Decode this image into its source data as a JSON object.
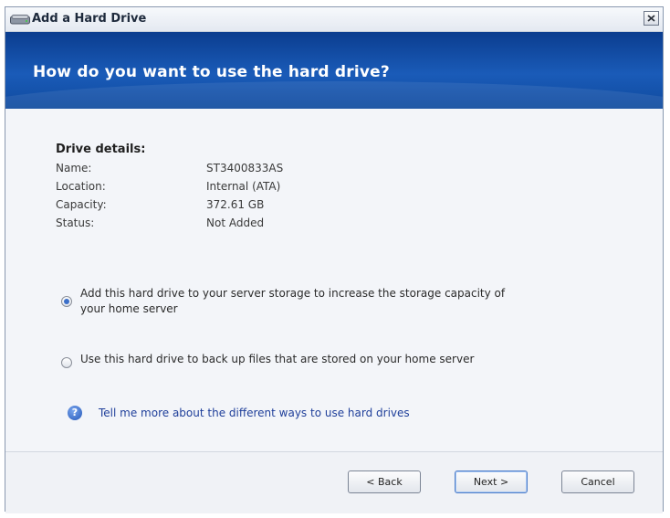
{
  "window": {
    "title": "Add a Hard Drive",
    "close_label": "×"
  },
  "header": {
    "title": "How do you want to use the hard drive?"
  },
  "details": {
    "title": "Drive details:",
    "rows": [
      {
        "label": "Name:",
        "value": "ST3400833AS"
      },
      {
        "label": "Location:",
        "value": "Internal (ATA)"
      },
      {
        "label": "Capacity:",
        "value": "372.61 GB"
      },
      {
        "label": "Status:",
        "value": "Not Added"
      }
    ]
  },
  "options": [
    {
      "line1": "Add this hard drive to your server storage to increase the storage capacity of",
      "line2": "your home server",
      "selected": true
    },
    {
      "line1": "Use this hard drive to back up files that are stored on your home server",
      "selected": false
    }
  ],
  "help": {
    "icon": "question-icon",
    "glyph": "?",
    "link": "Tell me more about the different ways to use hard drives"
  },
  "buttons": {
    "back": "< Back",
    "next": "Next >",
    "cancel": "Cancel"
  }
}
